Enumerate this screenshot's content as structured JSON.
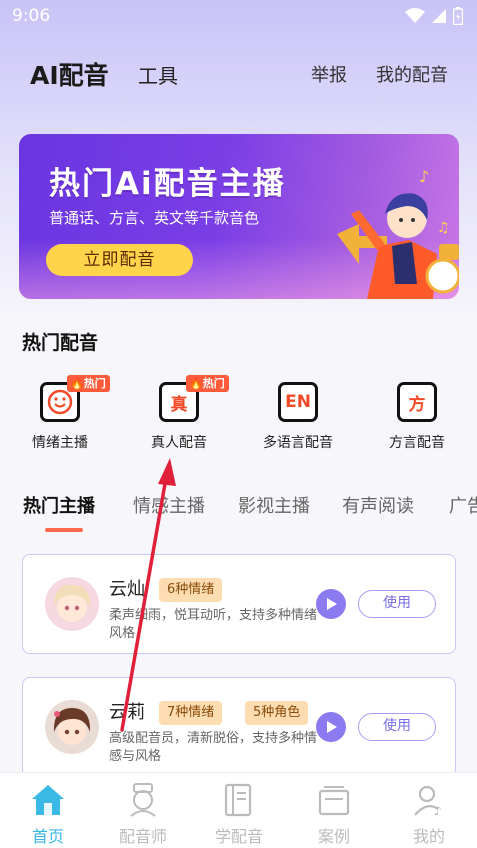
{
  "status": {
    "time": "9:06"
  },
  "header": {
    "app_title": "AI配音",
    "tools": "工具",
    "report": "举报",
    "my_dubbing": "我的配音"
  },
  "banner": {
    "title": "热门Ai配音主播",
    "subtitle": "普通话、方言、英文等千款音色",
    "button": "立即配音"
  },
  "hot_section": {
    "title": "热门配音",
    "categories": [
      {
        "label": "情绪主播",
        "icon": "smiley-icon",
        "badge": "热门"
      },
      {
        "label": "真人配音",
        "icon_text": "真",
        "badge": "热门"
      },
      {
        "label": "多语言配音",
        "icon_text": "EN"
      },
      {
        "label": "方言配音",
        "icon_text": "方"
      }
    ]
  },
  "tabs": [
    {
      "label": "热门主播",
      "active": true
    },
    {
      "label": "情感主播"
    },
    {
      "label": "影视主播"
    },
    {
      "label": "有声阅读"
    },
    {
      "label": "广告"
    }
  ],
  "hosts": [
    {
      "name": "云灿",
      "tags": [
        "6种情绪"
      ],
      "desc": "柔声细雨，悦耳动听，支持多种情绪风格",
      "action": "使用"
    },
    {
      "name": "云莉",
      "tags": [
        "7种情绪",
        "5种角色"
      ],
      "desc": "高级配音员，清新脱俗，支持多种情感与风格",
      "action": "使用"
    }
  ],
  "bottom_nav": [
    {
      "label": "首页",
      "icon": "home-icon",
      "active": true
    },
    {
      "label": "配音师",
      "icon": "voice-actor-icon"
    },
    {
      "label": "学配音",
      "icon": "book-icon"
    },
    {
      "label": "案例",
      "icon": "cases-icon"
    },
    {
      "label": "我的",
      "icon": "profile-icon"
    }
  ],
  "colors": {
    "accent": "#ff6a4a",
    "purple": "#7a3ee6",
    "active_tab": "#3ab8e6",
    "annotation_arrow": "#e0203a"
  }
}
